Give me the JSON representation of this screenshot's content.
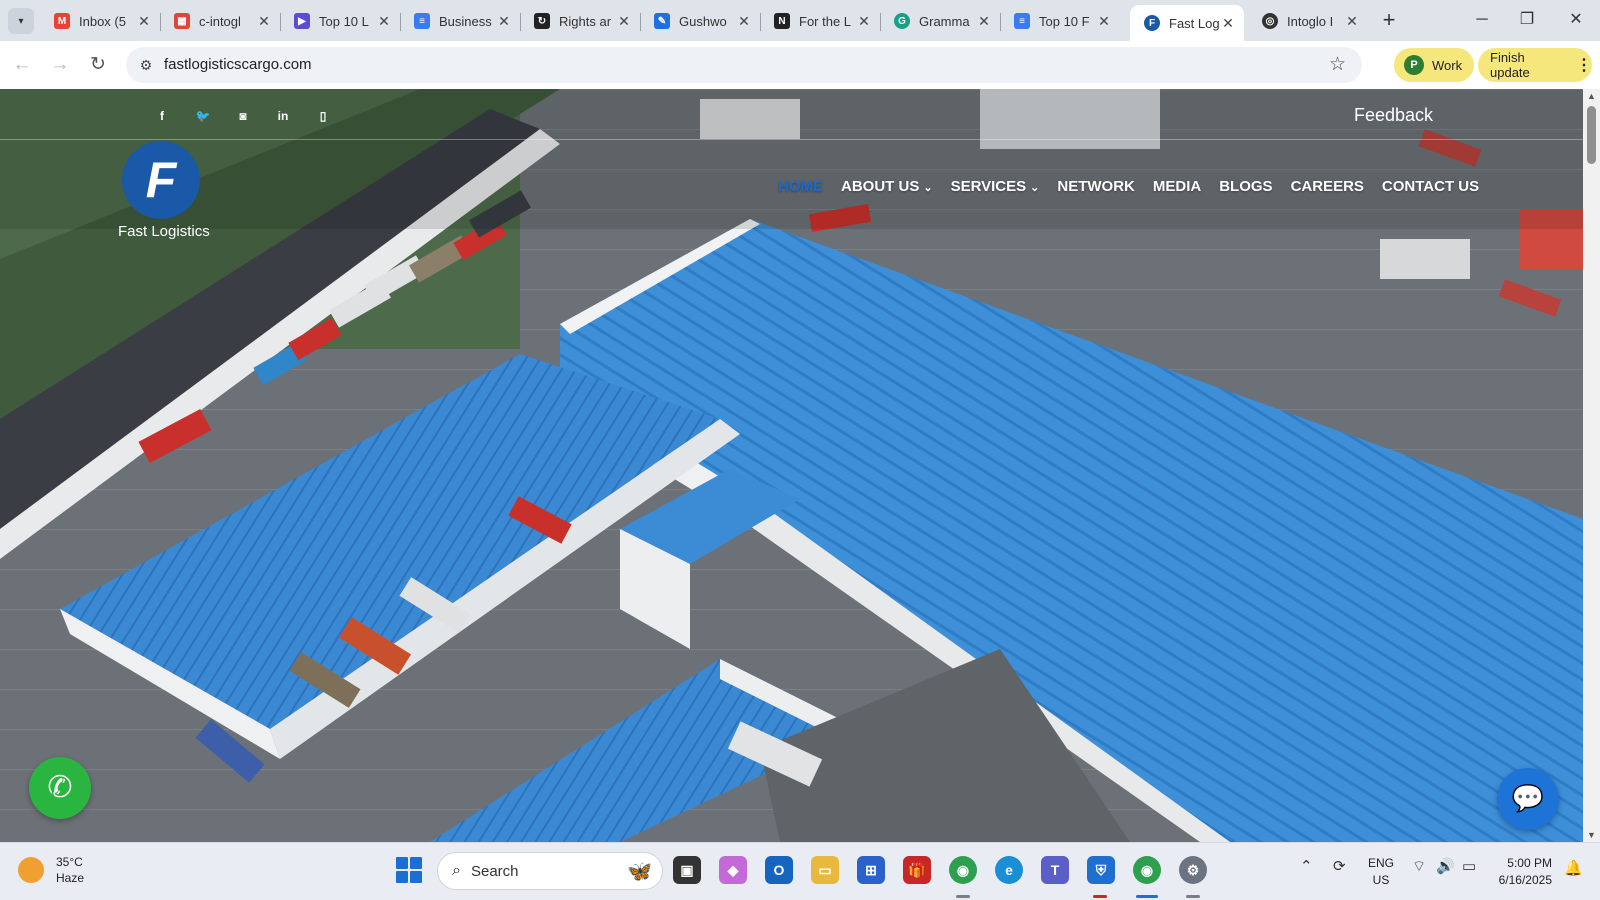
{
  "browser": {
    "tabs": [
      {
        "title": "Inbox (5",
        "icon": "gmail-icon",
        "color": "#ea4335"
      },
      {
        "title": "c-intogl",
        "icon": "sheets-icon",
        "color": "#e0443a"
      },
      {
        "title": "Top 10 L",
        "icon": "play-icon",
        "color": "#5b4bd6"
      },
      {
        "title": "Business",
        "icon": "docs-icon",
        "color": "#3a7bf0"
      },
      {
        "title": "Rights ar",
        "icon": "recaptcha-icon",
        "color": "#222222"
      },
      {
        "title": "Gushwo",
        "icon": "quill-icon",
        "color": "#1f6fe0"
      },
      {
        "title": "For the L",
        "icon": "notion-icon",
        "color": "#222222"
      },
      {
        "title": "Gramma",
        "icon": "grammarly-icon",
        "color": "#16a085"
      },
      {
        "title": "Top 10 F",
        "icon": "docs-icon",
        "color": "#3a7bf0"
      },
      {
        "title": "Fast Log",
        "icon": "fastlogistics-icon",
        "color": "#1a58a8",
        "active": true
      },
      {
        "title": "Intoglo I",
        "icon": "intoglo-icon",
        "color": "#333333"
      }
    ],
    "url": "fastlogisticscargo.com",
    "profile_initial": "P",
    "profile_label": "Work",
    "update_label": "Finish update"
  },
  "site": {
    "feedback_label": "Feedback",
    "logo_letter": "F",
    "logo_name": "Fast Logistics",
    "social_icons": [
      "facebook-icon",
      "twitter-icon",
      "instagram-icon",
      "linkedin-icon",
      "phone-icon"
    ],
    "nav": [
      {
        "label": "HOME",
        "active": true
      },
      {
        "label": "ABOUT US",
        "dropdown": true
      },
      {
        "label": "SERVICES",
        "dropdown": true
      },
      {
        "label": "NETWORK"
      },
      {
        "label": "MEDIA"
      },
      {
        "label": "BLOGS"
      },
      {
        "label": "CAREERS"
      },
      {
        "label": "CONTACT US"
      }
    ],
    "accent_color": "#1d69c9",
    "hero_description": "Aerial view of a large warehouse complex with blue roofs and trucks at loading docks"
  },
  "taskbar": {
    "weather_temp": "35°C",
    "weather_desc": "Haze",
    "search_placeholder": "Search",
    "lang_top": "ENG",
    "lang_bottom": "US",
    "time": "5:00 PM",
    "date": "6/16/2025"
  }
}
